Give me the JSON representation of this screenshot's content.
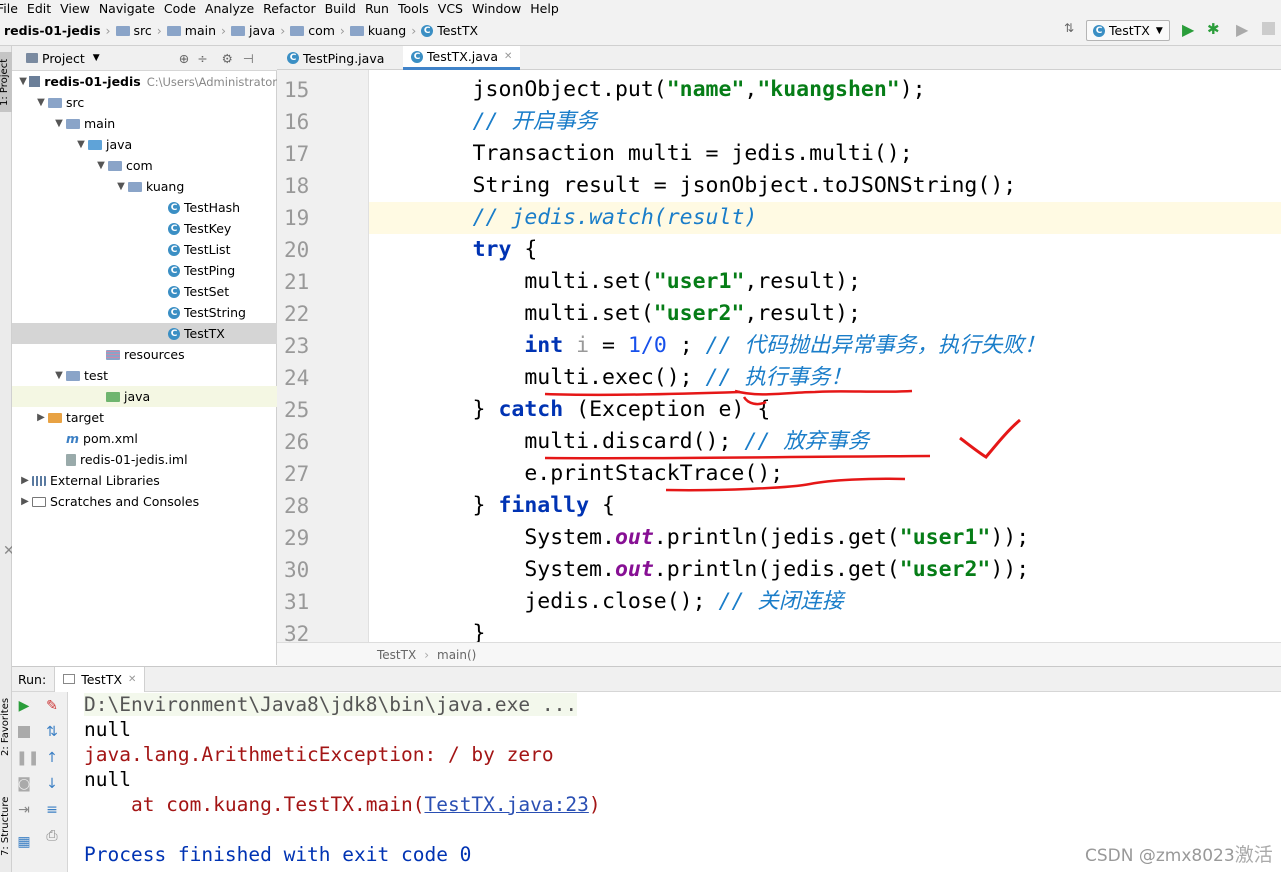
{
  "menu": {
    "items": [
      "File",
      "Edit",
      "View",
      "Navigate",
      "Code",
      "Analyze",
      "Refactor",
      "Build",
      "Run",
      "Tools",
      "VCS",
      "Window",
      "Help"
    ]
  },
  "navbar": {
    "crumbs": [
      "redis-01-jedis",
      "src",
      "main",
      "java",
      "com",
      "kuang",
      "TestTX"
    ],
    "run_config": "TestTX"
  },
  "project": {
    "header": "Project",
    "items": [
      {
        "label": "redis-01-jedis",
        "path": "C:\\Users\\Administrator"
      },
      {
        "label": "src"
      },
      {
        "label": "main"
      },
      {
        "label": "java"
      },
      {
        "label": "com"
      },
      {
        "label": "kuang"
      },
      {
        "label": "TestHash"
      },
      {
        "label": "TestKey"
      },
      {
        "label": "TestList"
      },
      {
        "label": "TestPing"
      },
      {
        "label": "TestSet"
      },
      {
        "label": "TestString"
      },
      {
        "label": "TestTX"
      },
      {
        "label": "resources"
      },
      {
        "label": "test"
      },
      {
        "label": "java"
      },
      {
        "label": "target"
      },
      {
        "label": "pom.xml"
      },
      {
        "label": "redis-01-jedis.iml"
      },
      {
        "label": "External Libraries"
      },
      {
        "label": "Scratches and Consoles"
      }
    ],
    "side_tab": "1: Project"
  },
  "tabs": [
    "TestPing.java",
    "TestTX.java"
  ],
  "editor": {
    "line_numbers": [
      "15",
      "16",
      "17",
      "18",
      "19",
      "20",
      "21",
      "22",
      "23",
      "24",
      "25",
      "26",
      "27",
      "28",
      "29",
      "30",
      "31",
      "32"
    ],
    "lines": [
      [
        {
          "t": "        jsonObject.put(",
          "c": ""
        },
        {
          "t": "\"name\"",
          "c": "str"
        },
        {
          "t": ",",
          "c": ""
        },
        {
          "t": "\"kuangshen\"",
          "c": "str"
        },
        {
          "t": ");",
          "c": ""
        }
      ],
      [
        {
          "t": "        ",
          "c": ""
        },
        {
          "t": "// 开启事务",
          "c": "cmt"
        }
      ],
      [
        {
          "t": "        Transaction multi = jedis.multi();",
          "c": ""
        }
      ],
      [
        {
          "t": "        String result = jsonObject.toJSONString();",
          "c": ""
        }
      ],
      [
        {
          "t": "        ",
          "c": ""
        },
        {
          "t": "// jedis.watch(result)",
          "c": "cmt"
        }
      ],
      [
        {
          "t": "        ",
          "c": ""
        },
        {
          "t": "try",
          "c": "kw"
        },
        {
          "t": " {",
          "c": ""
        }
      ],
      [
        {
          "t": "            multi.set(",
          "c": ""
        },
        {
          "t": "\"user1\"",
          "c": "str"
        },
        {
          "t": ",result);",
          "c": ""
        }
      ],
      [
        {
          "t": "            multi.set(",
          "c": ""
        },
        {
          "t": "\"user2\"",
          "c": "str"
        },
        {
          "t": ",result);",
          "c": ""
        }
      ],
      [
        {
          "t": "            ",
          "c": ""
        },
        {
          "t": "int",
          "c": "kw"
        },
        {
          "t": " ",
          "c": ""
        },
        {
          "t": "i",
          "c": "gray"
        },
        {
          "t": " = ",
          "c": ""
        },
        {
          "t": "1/0",
          "c": "num"
        },
        {
          "t": " ; ",
          "c": ""
        },
        {
          "t": "// 代码抛出异常事务，执行失败！",
          "c": "cmt"
        }
      ],
      [
        {
          "t": "            multi.exec(); ",
          "c": ""
        },
        {
          "t": "// 执行事务！",
          "c": "cmt"
        }
      ],
      [
        {
          "t": "        } ",
          "c": ""
        },
        {
          "t": "catch",
          "c": "kw"
        },
        {
          "t": " (Exception e) {",
          "c": ""
        }
      ],
      [
        {
          "t": "            multi.discard(); ",
          "c": ""
        },
        {
          "t": "// 放弃事务",
          "c": "cmt"
        }
      ],
      [
        {
          "t": "            e.printStackTrace();",
          "c": ""
        }
      ],
      [
        {
          "t": "        } ",
          "c": ""
        },
        {
          "t": "finally",
          "c": "kw"
        },
        {
          "t": " {",
          "c": ""
        }
      ],
      [
        {
          "t": "            System.",
          "c": ""
        },
        {
          "t": "out",
          "c": "fld"
        },
        {
          "t": ".println(jedis.get(",
          "c": ""
        },
        {
          "t": "\"user1\"",
          "c": "str"
        },
        {
          "t": "));",
          "c": ""
        }
      ],
      [
        {
          "t": "            System.",
          "c": ""
        },
        {
          "t": "out",
          "c": "fld"
        },
        {
          "t": ".println(jedis.get(",
          "c": ""
        },
        {
          "t": "\"user2\"",
          "c": "str"
        },
        {
          "t": "));",
          "c": ""
        }
      ],
      [
        {
          "t": "            jedis.close(); ",
          "c": ""
        },
        {
          "t": "// 关闭连接",
          "c": "cmt"
        }
      ],
      [
        {
          "t": "        }",
          "c": ""
        }
      ]
    ],
    "breadcrumb": [
      "TestTX",
      "main()"
    ]
  },
  "run": {
    "label": "Run:",
    "tab": "TestTX",
    "console": [
      {
        "text": "D:\\Environment\\Java8\\jdk8\\bin\\java.exe ...",
        "c": "cmdline"
      },
      {
        "text": "null",
        "c": ""
      },
      {
        "text": "java.lang.ArithmeticException: / by zero",
        "c": "err"
      },
      {
        "text": "null",
        "c": ""
      },
      {
        "text": "    at com.kuang.TestTX.main(",
        "c": "err",
        "link": "TestTX.java:23",
        "after": ")"
      },
      {
        "text": "",
        "c": ""
      },
      {
        "text": "Process finished with exit code 0",
        "c": "exit"
      }
    ],
    "side_tabs": [
      "2: Favorites",
      "7: Structure"
    ]
  },
  "watermark": "CSDN @zmx8023",
  "overlay_text": "激活"
}
